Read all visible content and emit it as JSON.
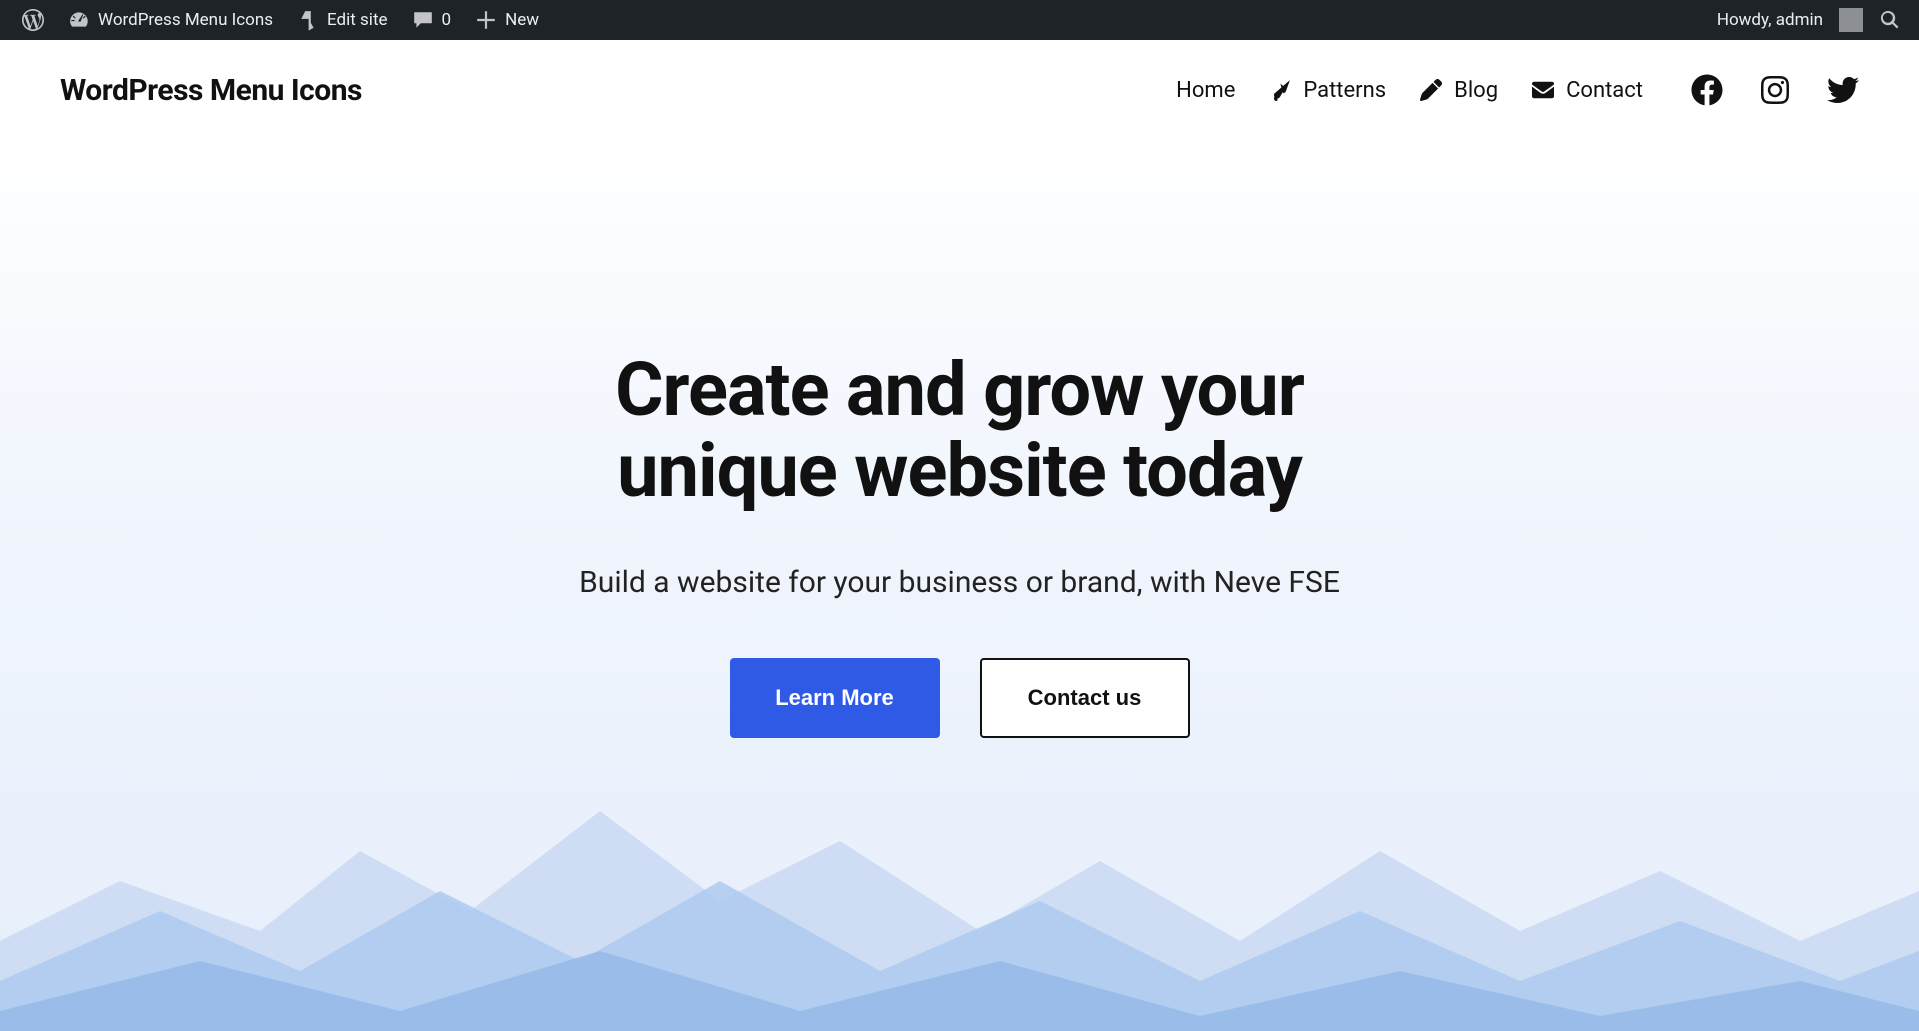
{
  "admin_bar": {
    "site_name": "WordPress Menu Icons",
    "edit_site": "Edit site",
    "comments_count": "0",
    "new_label": "New",
    "greeting": "Howdy, admin"
  },
  "header": {
    "site_title": "WordPress Menu Icons",
    "nav": [
      {
        "label": "Home",
        "icon": null
      },
      {
        "label": "Patterns",
        "icon": "brush"
      },
      {
        "label": "Blog",
        "icon": "pencil"
      },
      {
        "label": "Contact",
        "icon": "envelope"
      }
    ],
    "social": [
      "facebook",
      "instagram",
      "twitter"
    ]
  },
  "hero": {
    "title_l1": "Create and grow your",
    "title_l2": "unique website today",
    "subtitle": "Build a website for your business or brand, with Neve FSE",
    "cta_primary": "Learn More",
    "cta_secondary": "Contact us"
  }
}
